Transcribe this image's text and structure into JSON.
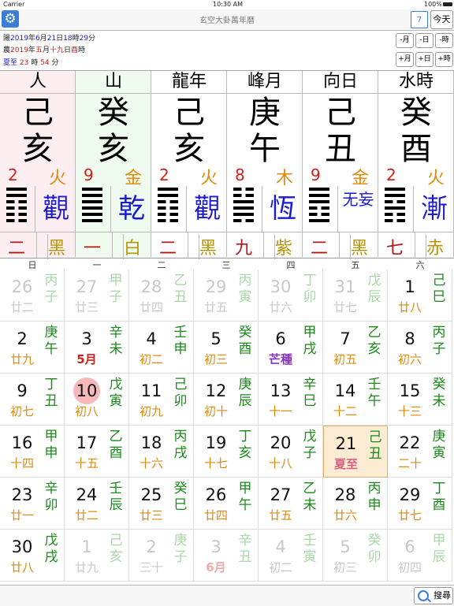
{
  "status": {
    "carrier": "Carrier",
    "time": "10:30 AM",
    "battery": "100%"
  },
  "nav": {
    "title": "玄空大卦萬年曆",
    "calendar_icon_text": "7",
    "today_label": "今天",
    "settings_icon": "gear-icon"
  },
  "info": {
    "solar": {
      "prefix": "陽",
      "year": "2019",
      "yl": "年",
      "month": "6",
      "ml": "月",
      "day": "21",
      "dl": "日",
      "hour": "18",
      "hl": "時",
      "minute": "29",
      "minl": "分"
    },
    "lunar": {
      "prefix": "農",
      "year": "2019",
      "yl": "年",
      "month": "五",
      "ml": "月",
      "day": "十九",
      "dl": "日",
      "hour": "酉",
      "hl": "時"
    },
    "term": {
      "name": "夏至",
      "h": "23",
      "hl": "時",
      "m": "54",
      "ml": "分"
    },
    "buttons": {
      "prev_month": "-月",
      "prev_day": "-日",
      "prev_hour": "-時",
      "next_month": "+月",
      "next_day": "+日",
      "next_hour": "+時"
    }
  },
  "bagua": [
    {
      "label": "人",
      "gan": "己",
      "zhi": "亥",
      "num": "2",
      "elem": "火",
      "gua": "觀",
      "lines": [
        "y",
        "y",
        "n",
        "n",
        "n",
        "n"
      ],
      "star1": "二",
      "star2": "黑",
      "bg": "#fdeef2"
    },
    {
      "label": "山",
      "gan": "癸",
      "zhi": "亥",
      "num": "9",
      "elem": "金",
      "gua": "乾",
      "lines": [
        "y",
        "y",
        "y",
        "y",
        "y",
        "y"
      ],
      "star1": "一",
      "star2": "白",
      "bg": "#eefbee"
    },
    {
      "label": "龍年",
      "gan": "己",
      "zhi": "亥",
      "num": "2",
      "elem": "火",
      "gua": "觀",
      "lines": [
        "y",
        "y",
        "n",
        "n",
        "n",
        "n"
      ],
      "star1": "二",
      "star2": "黑",
      "bg": "#ffffff"
    },
    {
      "label": "峰月",
      "gan": "庚",
      "zhi": "午",
      "num": "8",
      "elem": "木",
      "gua": "恆",
      "lines": [
        "n",
        "n",
        "y",
        "y",
        "y",
        "n"
      ],
      "star1": "九",
      "star2": "紫",
      "bg": "#ffffff"
    },
    {
      "label": "向日",
      "gan": "己",
      "zhi": "丑",
      "num": "9",
      "elem": "金",
      "gua": "无妄",
      "lines": [
        "y",
        "y",
        "y",
        "n",
        "n",
        "y"
      ],
      "star1": "二",
      "star2": "黑",
      "bg": "#ffffff"
    },
    {
      "label": "水時",
      "gan": "癸",
      "zhi": "酉",
      "num": "2",
      "elem": "火",
      "gua": "漸",
      "lines": [
        "y",
        "y",
        "n",
        "y",
        "n",
        "n"
      ],
      "star1": "七",
      "star2": "赤",
      "bg": "#ffffff"
    }
  ],
  "weekdays": [
    "日",
    "一",
    "二",
    "三",
    "四",
    "五",
    "六"
  ],
  "calendar": [
    [
      {
        "d": "26",
        "l": "廿二",
        "gz": "丙子",
        "dim": true
      },
      {
        "d": "27",
        "l": "廿三",
        "gz": "甲子",
        "dim": true
      },
      {
        "d": "28",
        "l": "廿四",
        "gz": "乙丑",
        "dim": true
      },
      {
        "d": "29",
        "l": "廿五",
        "gz": "丙寅",
        "dim": true
      },
      {
        "d": "30",
        "l": "廿六",
        "gz": "丁卯",
        "dim": true
      },
      {
        "d": "31",
        "l": "廿七",
        "gz": "戊辰",
        "dim": true
      },
      {
        "d": "1",
        "l": "廿八",
        "gz": "己巳"
      }
    ],
    [
      {
        "d": "2",
        "l": "廿九",
        "gz": "庚午"
      },
      {
        "d": "3",
        "l": "5月",
        "gz": "辛未",
        "lc": "red"
      },
      {
        "d": "4",
        "l": "初二",
        "gz": "壬申"
      },
      {
        "d": "5",
        "l": "初三",
        "gz": "癸酉"
      },
      {
        "d": "6",
        "l": "芒種",
        "gz": "甲戌",
        "lc": "purple"
      },
      {
        "d": "7",
        "l": "初五",
        "gz": "乙亥"
      },
      {
        "d": "8",
        "l": "初六",
        "gz": "丙子"
      }
    ],
    [
      {
        "d": "9",
        "l": "初七",
        "gz": "丁丑"
      },
      {
        "d": "10",
        "l": "初八",
        "gz": "戊寅",
        "sel": true
      },
      {
        "d": "11",
        "l": "初九",
        "gz": "己卯"
      },
      {
        "d": "12",
        "l": "初十",
        "gz": "庚辰"
      },
      {
        "d": "13",
        "l": "十一",
        "gz": "辛巳"
      },
      {
        "d": "14",
        "l": "十二",
        "gz": "壬午"
      },
      {
        "d": "15",
        "l": "十三",
        "gz": "癸未"
      }
    ],
    [
      {
        "d": "16",
        "l": "十四",
        "gz": "甲申"
      },
      {
        "d": "17",
        "l": "十五",
        "gz": "乙酉"
      },
      {
        "d": "18",
        "l": "十六",
        "gz": "丙戌"
      },
      {
        "d": "19",
        "l": "十七",
        "gz": "丁亥"
      },
      {
        "d": "20",
        "l": "十八",
        "gz": "戊子"
      },
      {
        "d": "21",
        "l": "夏至",
        "gz": "己丑",
        "today": true
      },
      {
        "d": "22",
        "l": "二十",
        "gz": "庚寅"
      }
    ],
    [
      {
        "d": "23",
        "l": "廿一",
        "gz": "辛卯"
      },
      {
        "d": "24",
        "l": "廿二",
        "gz": "壬辰"
      },
      {
        "d": "25",
        "l": "廿三",
        "gz": "癸巳"
      },
      {
        "d": "26",
        "l": "廿四",
        "gz": "甲午"
      },
      {
        "d": "27",
        "l": "廿五",
        "gz": "乙未"
      },
      {
        "d": "28",
        "l": "廿六",
        "gz": "丙申"
      },
      {
        "d": "29",
        "l": "廿七",
        "gz": "丁酉"
      }
    ],
    [
      {
        "d": "30",
        "l": "廿八",
        "gz": "戊戌"
      },
      {
        "d": "1",
        "l": "廿九",
        "gz": "己亥",
        "dim": true
      },
      {
        "d": "2",
        "l": "三十",
        "gz": "庚子",
        "dim": true
      },
      {
        "d": "3",
        "l": "6月",
        "gz": "辛丑",
        "dim": true,
        "lc": "red"
      },
      {
        "d": "4",
        "l": "初二",
        "gz": "壬寅",
        "dim": true
      },
      {
        "d": "5",
        "l": "初三",
        "gz": "癸卯",
        "dim": true
      },
      {
        "d": "6",
        "l": "初四",
        "gz": "甲辰",
        "dim": true
      }
    ]
  ],
  "bottom": {
    "search_label": "搜尋"
  },
  "colors": {
    "accent": "#3b7ed8",
    "red": "#d0201b",
    "orange": "#e08a10",
    "green": "#1b8a1b",
    "blue": "#1a1ad0"
  }
}
